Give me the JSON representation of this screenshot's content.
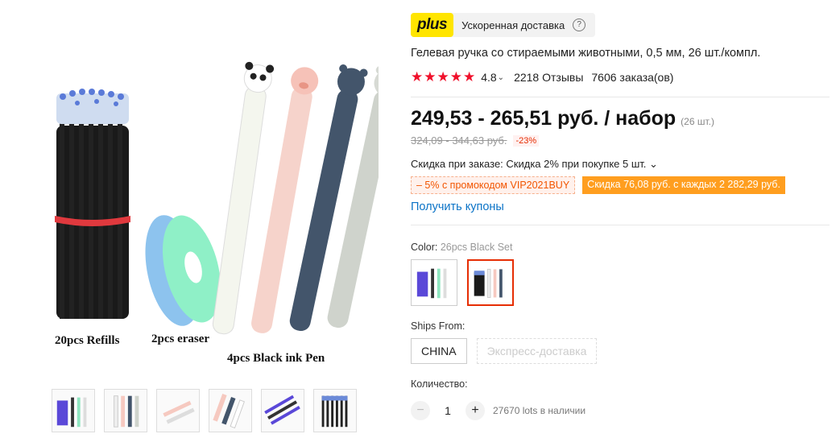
{
  "gallery": {
    "main_labels": {
      "refills": "20pcs Refills",
      "eraser": "2pcs eraser",
      "pens": "4pcs Black ink Pen"
    },
    "thumbnails": [
      "thumb-1",
      "thumb-2",
      "thumb-3",
      "thumb-4",
      "thumb-5",
      "thumb-6"
    ]
  },
  "shipping_badge": {
    "plus_label": "plus",
    "text": "Ускоренная доставка",
    "help_icon": "?"
  },
  "product": {
    "title": "Гелевая ручка со стираемыми животными, 0,5 мм, 26 шт./компл.",
    "stars": "★★★★★",
    "rating": "4.8",
    "rating_caret": "⌄",
    "reviews": "2218 Отзывы",
    "orders": "7606 заказа(ов)"
  },
  "price": {
    "current": "249,53 - 265,51 руб. / набор",
    "per_set": "(26 шт.)",
    "old": "324,09 - 344,63 руб.",
    "discount": "-23%"
  },
  "promotions": {
    "order_discount": "Скидка при заказе: Скидка 2% при покупке 5 шт. ⌄",
    "promo_code": "– 5% с промокодом VIP2021BUY",
    "store_discount": "Скидка 76,08 руб. с каждых 2 282,29 руб.",
    "coupons_link": "Получить купоны"
  },
  "color": {
    "label": "Color:",
    "selected": "26pcs Black Set"
  },
  "ships": {
    "label": "Ships From:",
    "options": [
      "CHINA",
      "Экспресс-доставка"
    ]
  },
  "quantity": {
    "label": "Количество:",
    "minus": "−",
    "value": "1",
    "plus": "+",
    "stock": "27670 lots в наличии"
  },
  "colors": {
    "accent": "#e62e04",
    "star": "#f0102b",
    "plus_yellow": "#ffe500",
    "link": "#0b73c7",
    "promo_orange": "#ff9e1f"
  }
}
